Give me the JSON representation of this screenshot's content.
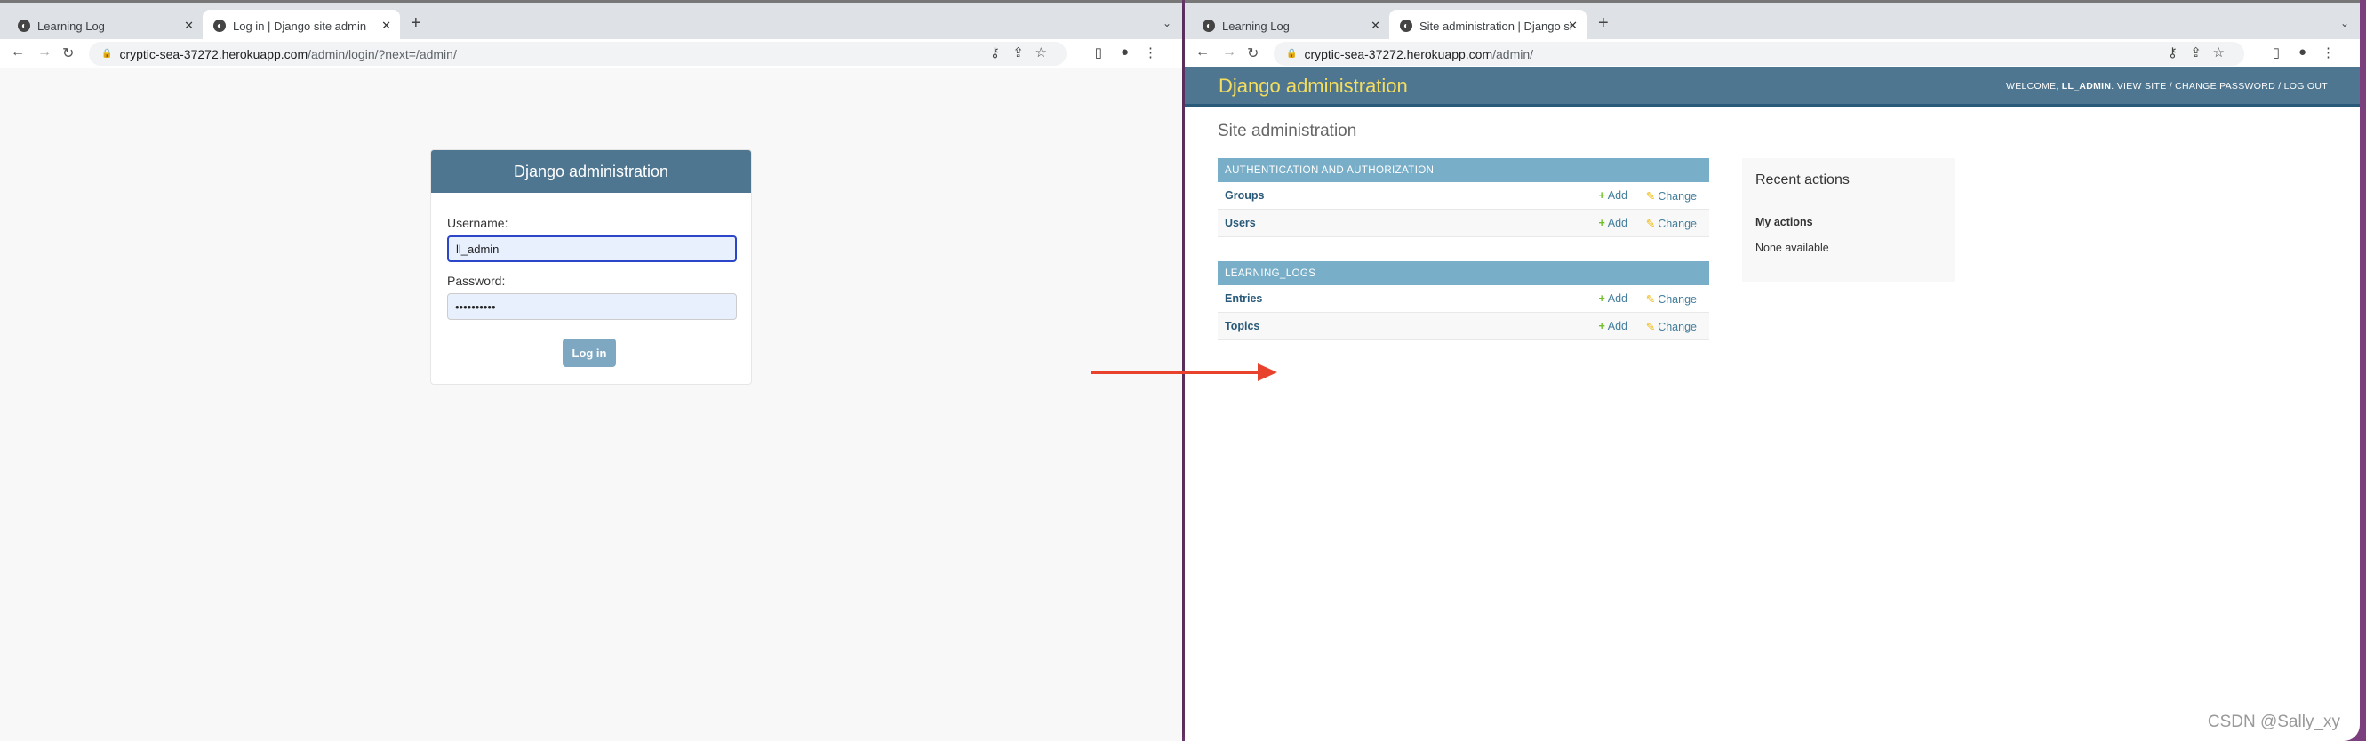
{
  "left_window": {
    "tabs": [
      {
        "label": "Learning Log"
      },
      {
        "label": "Log in | Django site admin"
      }
    ],
    "url": {
      "host": "cryptic-sea-37272.herokuapp.com",
      "path": "/admin/login/?next=/admin/"
    },
    "login": {
      "title": "Django administration",
      "username_label": "Username:",
      "username_value": "ll_admin",
      "password_label": "Password:",
      "password_value": "••••••••••",
      "submit": "Log in"
    }
  },
  "right_window": {
    "tabs": [
      {
        "label": "Learning Log"
      },
      {
        "label": "Site administration | Django sit"
      }
    ],
    "url": {
      "host": "cryptic-sea-37272.herokuapp.com",
      "path": "/admin/"
    },
    "header": {
      "brand": "Django administration",
      "welcome": "WELCOME, ",
      "user": "LL_ADMIN",
      "view_site": "VIEW SITE",
      "change_password": "CHANGE PASSWORD",
      "log_out": "LOG OUT",
      "sep": " / "
    },
    "title": "Site administration",
    "modules": [
      {
        "caption": "AUTHENTICATION AND AUTHORIZATION",
        "rows": [
          {
            "name": "Groups"
          },
          {
            "name": "Users"
          }
        ]
      },
      {
        "caption": "LEARNING_LOGS",
        "rows": [
          {
            "name": "Entries"
          },
          {
            "name": "Topics"
          }
        ]
      }
    ],
    "add_label": "Add",
    "change_label": "Change",
    "recent": {
      "title": "Recent actions",
      "my_actions": "My actions",
      "empty": "None available"
    }
  },
  "watermark": "CSDN @Sally_xy",
  "colors": {
    "header": "#4f7690",
    "caption": "#79aec8",
    "brand": "#f5dd5d",
    "arrow": "#e8412c"
  }
}
